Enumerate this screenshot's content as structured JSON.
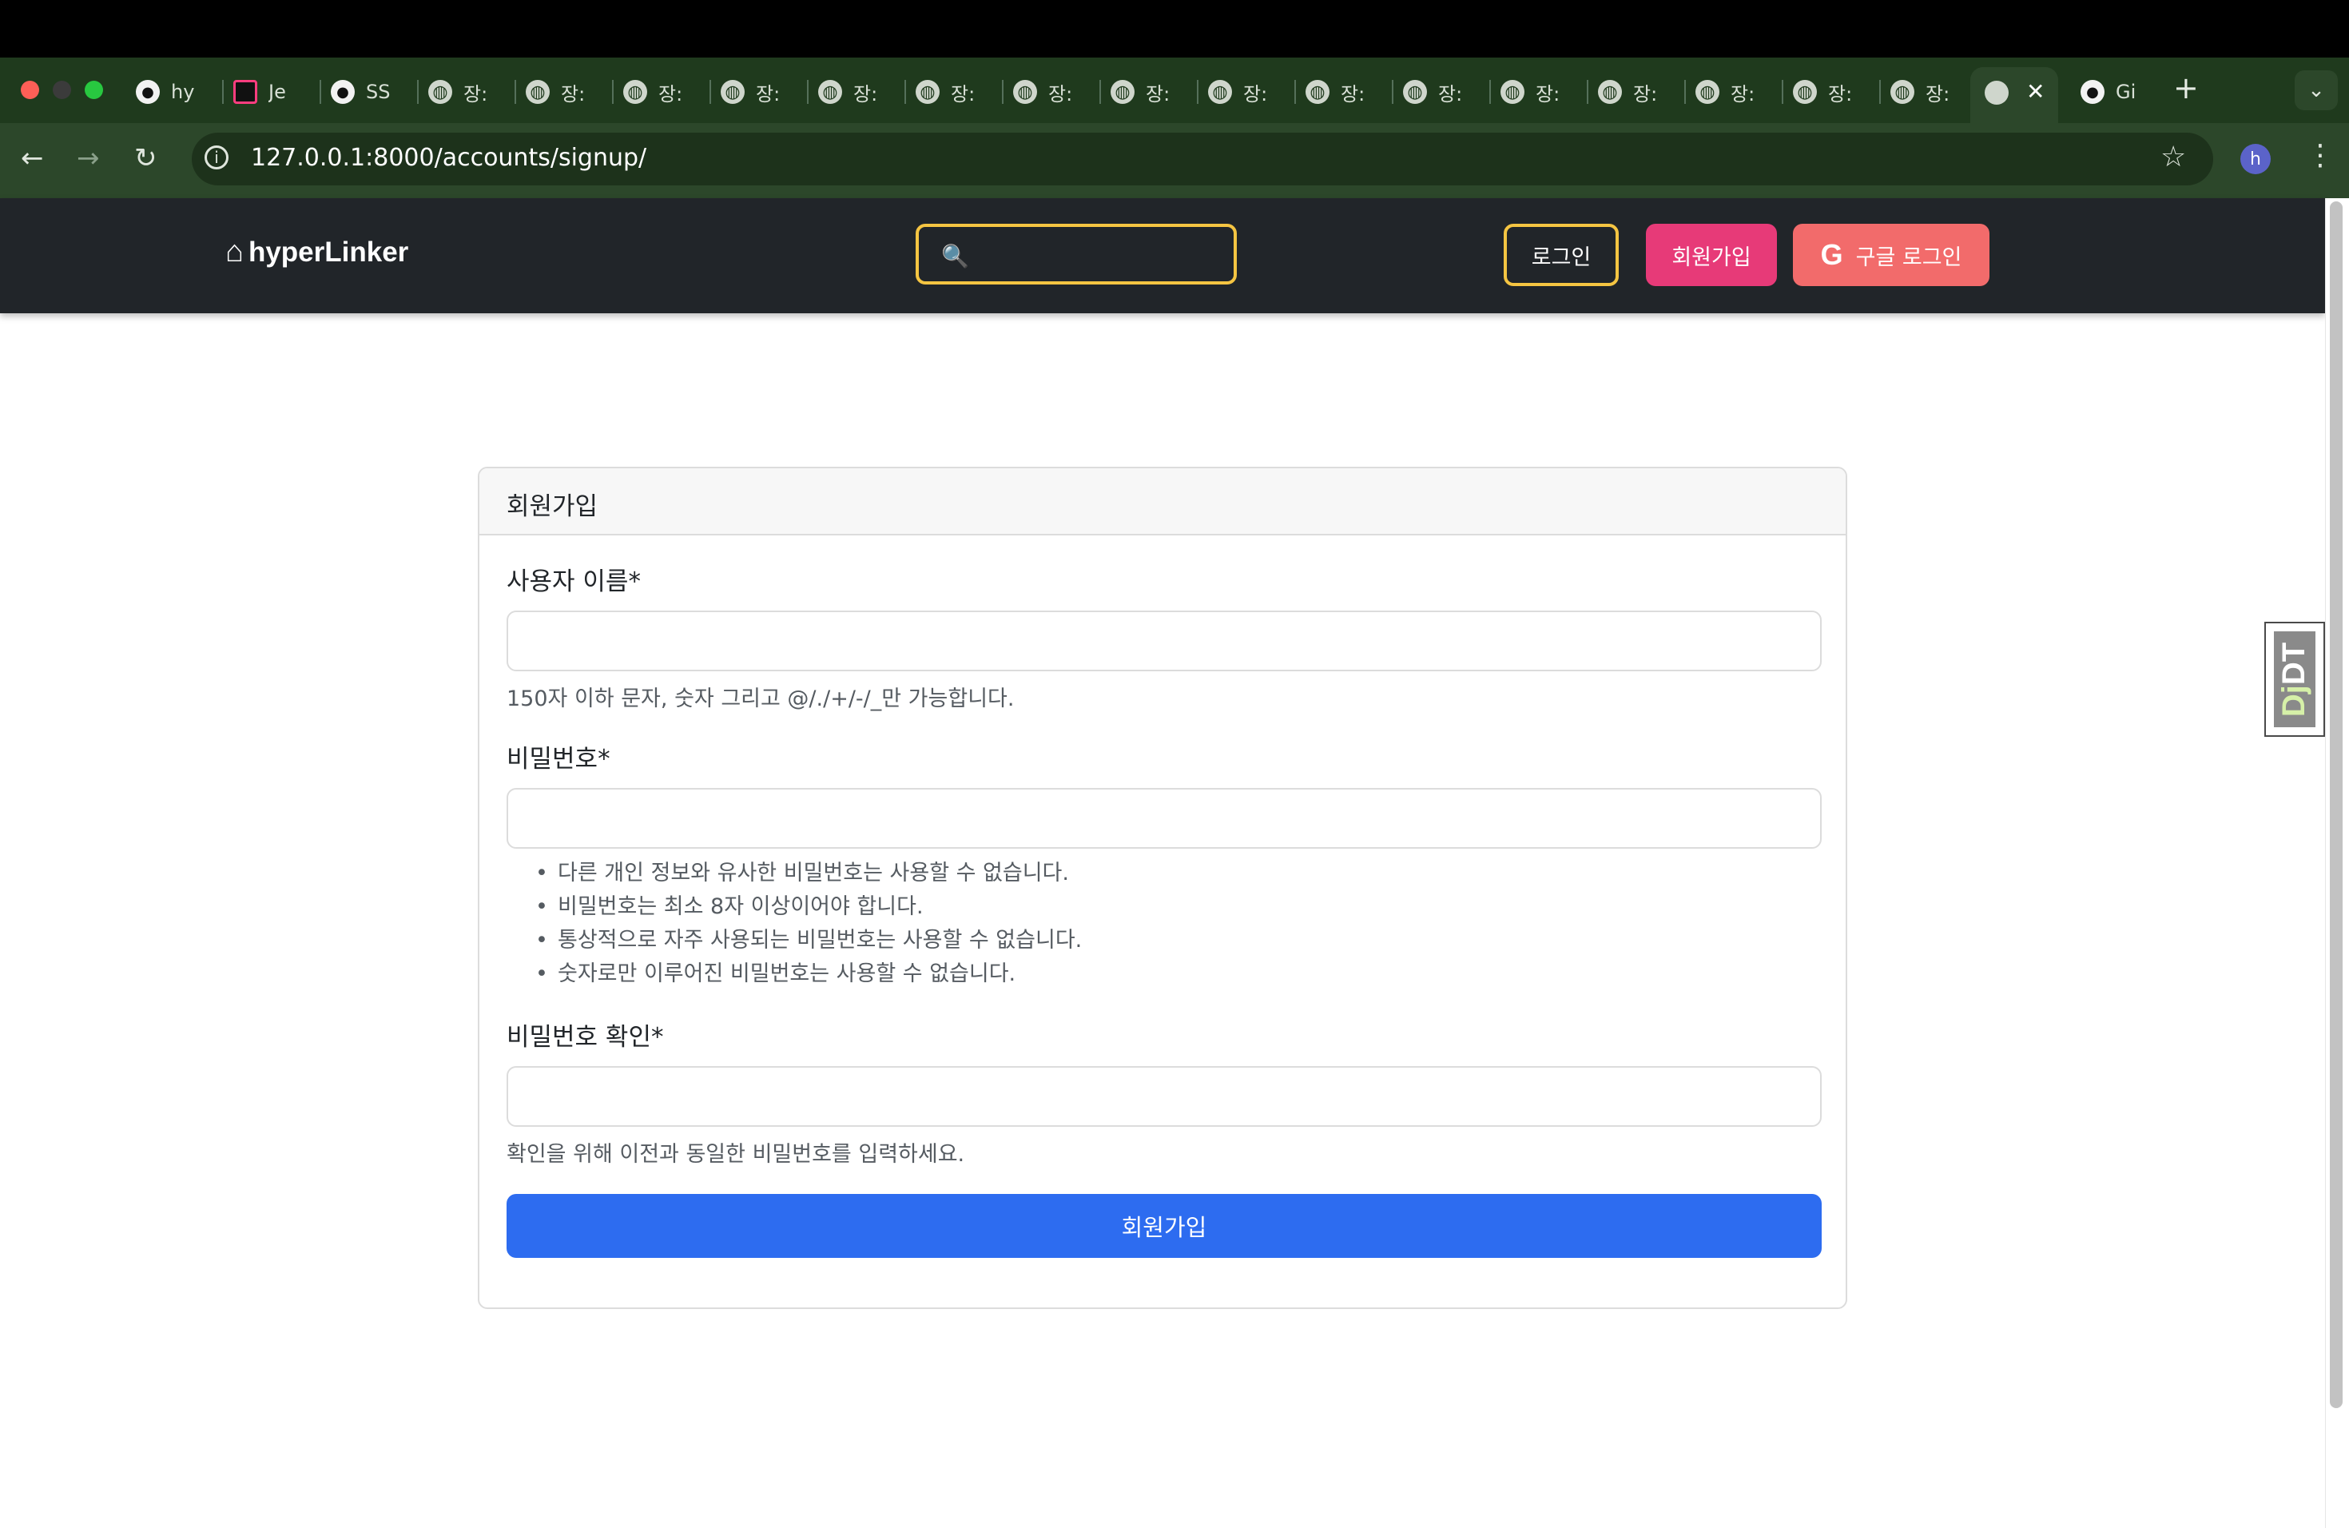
{
  "browser": {
    "tabs": [
      {
        "icon": "github-icon",
        "label": "hy"
      },
      {
        "icon": "jetbrains-icon",
        "label": "Je"
      },
      {
        "icon": "github-icon",
        "label": "SS"
      },
      {
        "icon": "globe-icon",
        "label": "장:"
      },
      {
        "icon": "globe-icon",
        "label": "장:"
      },
      {
        "icon": "globe-icon",
        "label": "장:"
      },
      {
        "icon": "globe-icon",
        "label": "장:"
      },
      {
        "icon": "globe-icon",
        "label": "장:"
      },
      {
        "icon": "globe-icon",
        "label": "장:"
      },
      {
        "icon": "globe-icon",
        "label": "장:"
      },
      {
        "icon": "globe-icon",
        "label": "장:"
      },
      {
        "icon": "globe-icon",
        "label": "장:"
      },
      {
        "icon": "globe-icon",
        "label": "장:"
      },
      {
        "icon": "globe-icon",
        "label": "장:"
      },
      {
        "icon": "globe-icon",
        "label": "장:"
      },
      {
        "icon": "globe-icon",
        "label": "장:"
      },
      {
        "icon": "globe-icon",
        "label": "장:"
      },
      {
        "icon": "globe-icon",
        "label": "장:"
      },
      {
        "icon": "globe-icon",
        "label": "장:"
      }
    ],
    "last_tab": {
      "icon": "github-icon",
      "label": "Gi"
    },
    "active_tab": {
      "icon": "globe-icon"
    },
    "url": "127.0.0.1:8000/accounts/signup/",
    "profile_initial": "h",
    "colors": {
      "tab_strip": "#1f3a1d",
      "toolbar": "#2c472a"
    }
  },
  "site": {
    "brand": "hyperLinker",
    "search": {
      "value": "",
      "placeholder": ""
    },
    "nav": {
      "login": "로그인",
      "signup": "회원가입",
      "google_login": "구글 로그인",
      "google_glyph": "G"
    },
    "colors": {
      "navbar": "#212529",
      "highlight": "#f5c542",
      "signup": "#e73a78",
      "google": "#f26b6b",
      "primary": "#2d6cf0"
    }
  },
  "form": {
    "title": "회원가입",
    "username": {
      "label": "사용자 이름*",
      "value": "",
      "help": "150자 이하 문자, 숫자 그리고 @/./+/-/_만 가능합니다."
    },
    "password": {
      "label": "비밀번호*",
      "value": "",
      "rules": [
        "다른 개인 정보와 유사한 비밀번호는 사용할 수 없습니다.",
        "비밀번호는 최소 8자 이상이어야 합니다.",
        "통상적으로 자주 사용되는 비밀번호는 사용할 수 없습니다.",
        "숫자로만 이루어진 비밀번호는 사용할 수 없습니다."
      ]
    },
    "password_confirm": {
      "label": "비밀번호 확인*",
      "value": "",
      "help": "확인을 위해 이전과 동일한 비밀번호를 입력하세요."
    },
    "submit": "회원가입"
  },
  "debug_toolbar": {
    "text_a": "Dj",
    "text_b": "DT"
  }
}
